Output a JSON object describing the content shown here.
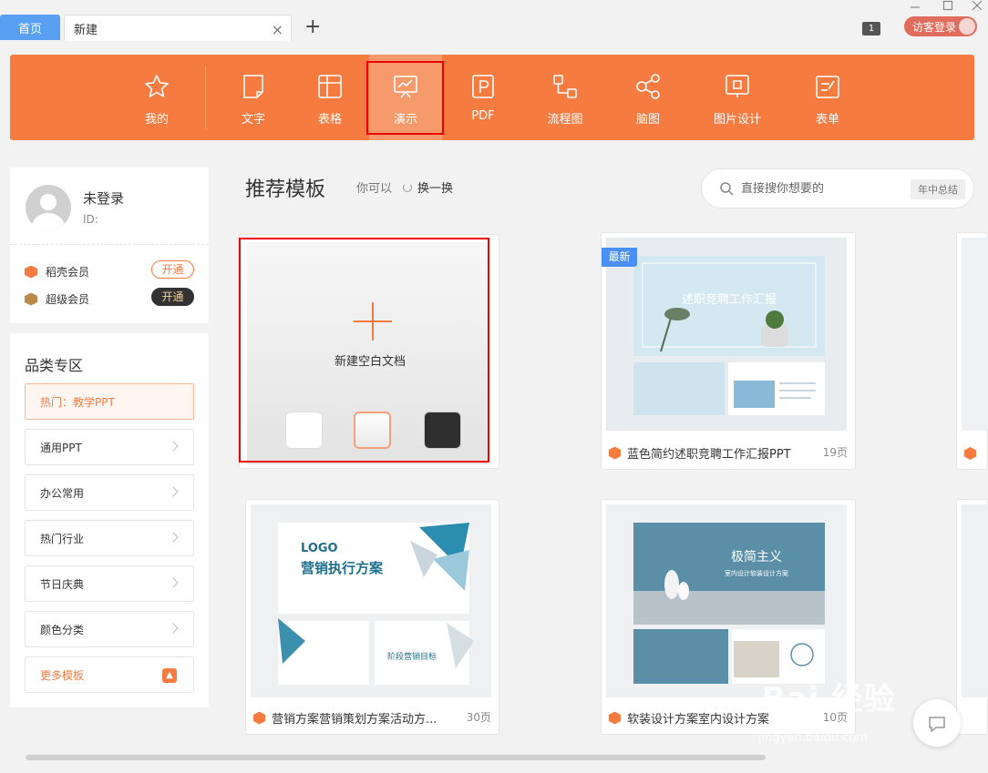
{
  "tabs": {
    "home": "首页",
    "new": "新建",
    "close": "×",
    "add": "+"
  },
  "window": {
    "counter": "1",
    "login_label": "访客登录"
  },
  "toolbar": {
    "items": [
      {
        "label": "我的",
        "icon": "star-icon"
      },
      {
        "label": "文字",
        "icon": "document-icon"
      },
      {
        "label": "表格",
        "icon": "table-icon"
      },
      {
        "label": "演示",
        "icon": "presentation-icon"
      },
      {
        "label": "PDF",
        "icon": "pdf-icon"
      },
      {
        "label": "流程图",
        "icon": "flowchart-icon"
      },
      {
        "label": "脑图",
        "icon": "mindmap-icon"
      },
      {
        "label": "图片设计",
        "icon": "image-design-icon"
      },
      {
        "label": "表单",
        "icon": "form-icon"
      }
    ],
    "active": "演示"
  },
  "user": {
    "name": "未登录",
    "id_label": "ID:"
  },
  "membership": [
    {
      "name": "稻壳会员",
      "action": "开通",
      "color": "#f57b40"
    },
    {
      "name": "超级会员",
      "action": "开通",
      "color": "#b98a4a"
    }
  ],
  "categories": {
    "title": "品类专区",
    "items": [
      "热门：教学PPT",
      "通用PPT",
      "办公常用",
      "热门行业",
      "节日庆典",
      "颜色分类",
      "更多模板"
    ]
  },
  "recommend": {
    "title": "推荐模板",
    "subtitle": "你可以",
    "refresh": "换一换"
  },
  "search": {
    "placeholder": "直接搜你想要的",
    "tag": "年中总结"
  },
  "blank": {
    "label": "新建空白文档"
  },
  "templates": [
    {
      "title": "蓝色简约述职竞聘工作汇报PPT",
      "pages": "19页",
      "badge": "最新",
      "thumb_title": "述职竞聘工作汇报"
    },
    {
      "title": "营销方案营销策划方案活动方...",
      "pages": "30页",
      "thumb_logo": "LOGO",
      "thumb_title": "营销执行方案",
      "thumb_sub": "阶段营销目标"
    },
    {
      "title": "软装设计方案室内设计方案",
      "pages": "10页",
      "thumb_title": "极简主义",
      "thumb_sub": "室内设计软装设计方案"
    }
  ],
  "watermark": {
    "main": "Bai 经验",
    "sub": "jingyan.baidu.com"
  },
  "accent": "#f57b40"
}
